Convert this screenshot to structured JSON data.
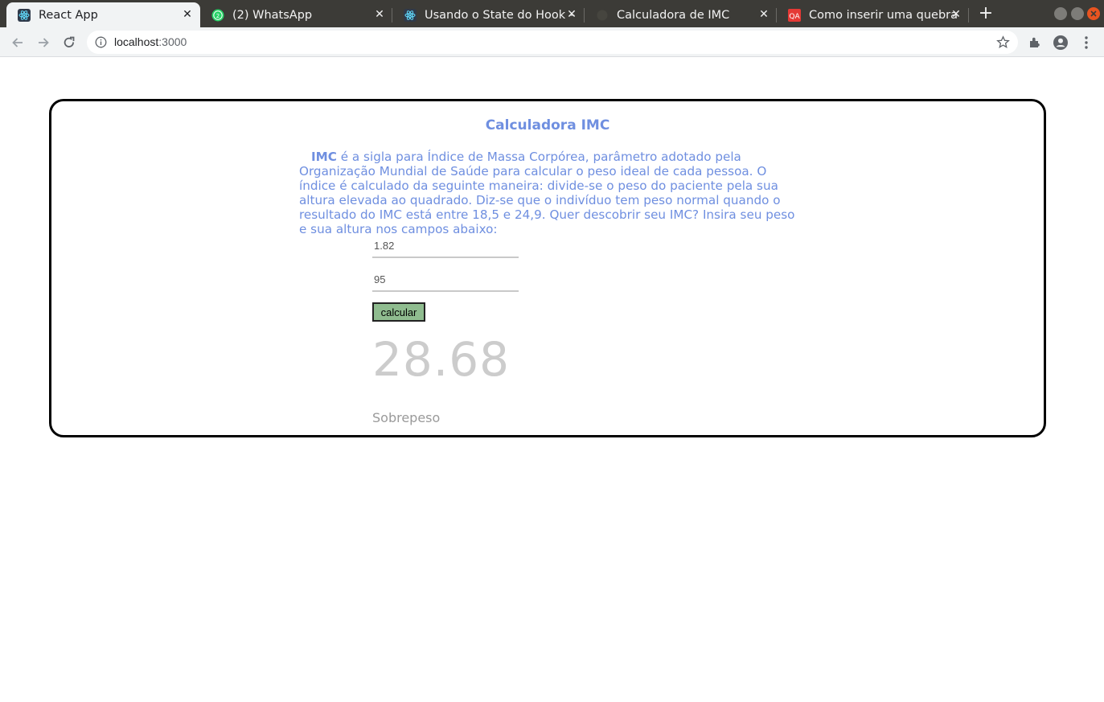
{
  "browser": {
    "tabs": [
      {
        "title": "React App",
        "favicon": "react-icon",
        "active": true
      },
      {
        "title": "(2) WhatsApp",
        "favicon": "whatsapp-icon",
        "active": false
      },
      {
        "title": "Usando o State do Hook – ",
        "favicon": "react-icon",
        "active": false
      },
      {
        "title": "Calculadora de IMC",
        "favicon": "blank-icon",
        "active": false
      },
      {
        "title": "Como inserir uma quebra",
        "favicon": "qa-icon",
        "favicon_text": "QA",
        "active": false
      }
    ],
    "url_host": "localhost",
    "url_port": ":3000",
    "colors": {
      "tabstrip": "#3c3b37",
      "toolbar": "#f1f3f4",
      "accent": "#6f8fe0",
      "button": "#8fbc8f"
    }
  },
  "page": {
    "title": "Calculadora IMC",
    "intro_bold": "IMC",
    "intro_text": " é a sigla para Índice de Massa Corpórea, parâmetro adotado pela Organização Mundial de Saúde para calcular o peso ideal de cada pessoa. O índice é calculado da seguinte maneira: divide-se o peso do paciente pela sua altura elevada ao quadrado. Diz-se que o indivíduo tem peso normal quando o resultado do IMC está entre 18,5 e 24,9. Quer descobrir seu IMC? Insira seu peso e sua altura nos campos abaixo:",
    "height_value": "1.82",
    "weight_value": "95",
    "button_label": "calcular",
    "result": "28.68",
    "classification": "Sobrepeso"
  }
}
